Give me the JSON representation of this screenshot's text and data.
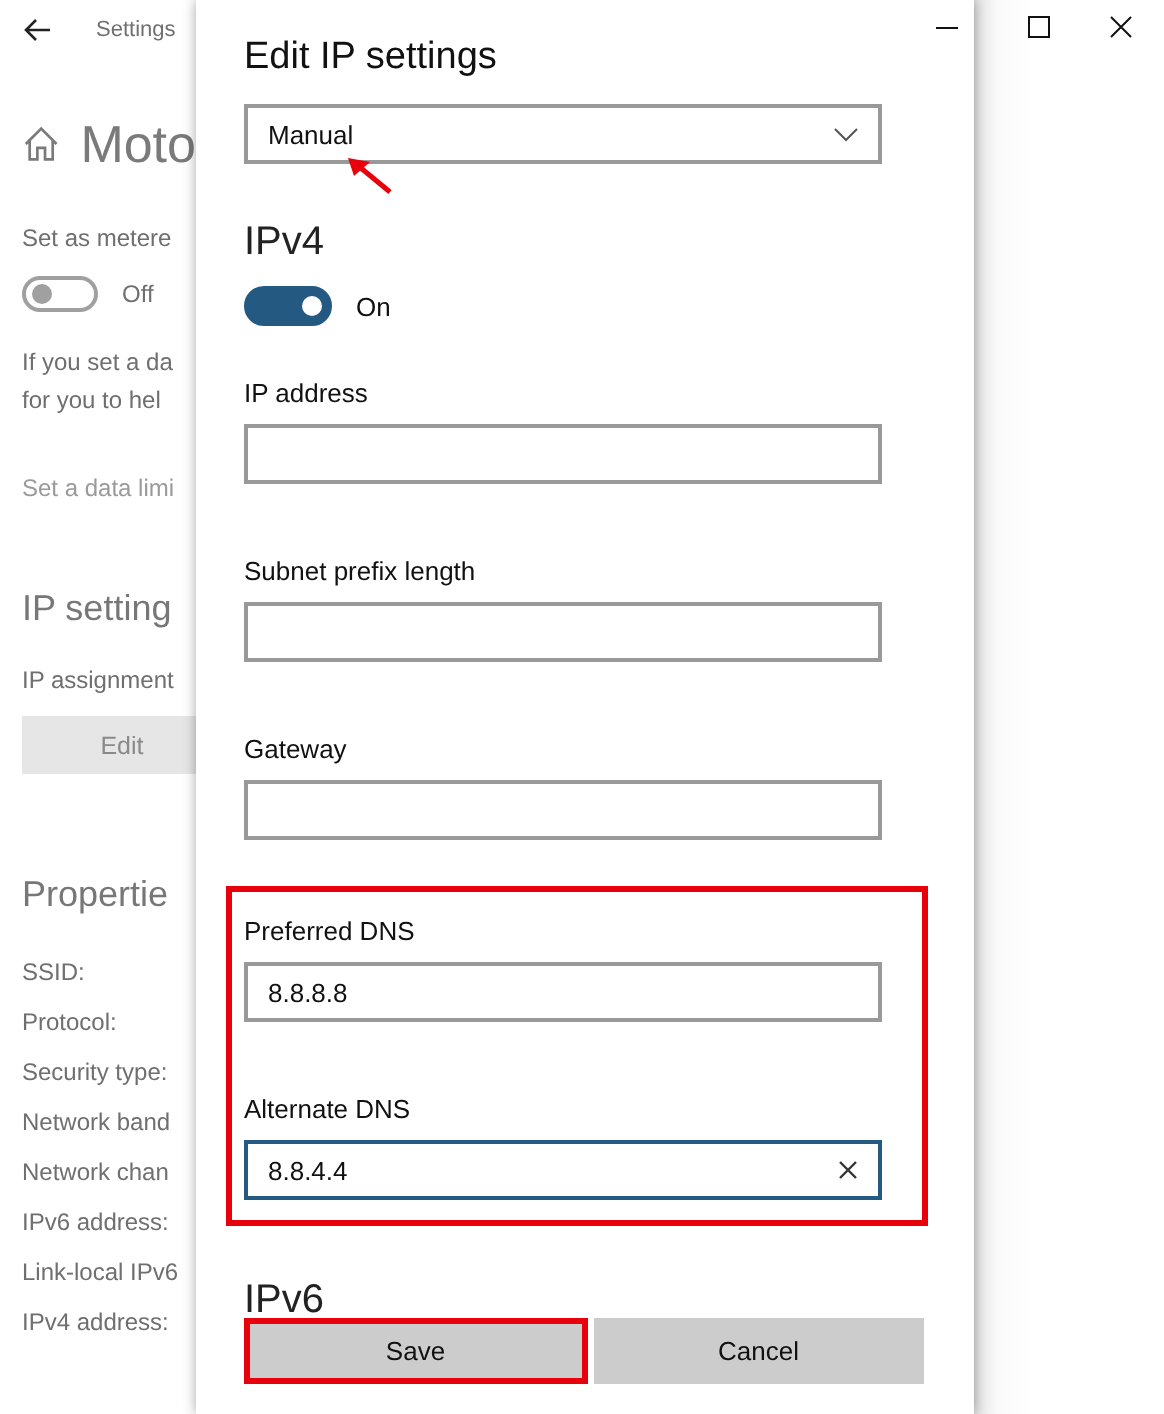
{
  "window": {
    "title": "Settings"
  },
  "background_page": {
    "heading": "Moto",
    "metered": {
      "label": "Set as metere",
      "on": false,
      "state_text": "Off"
    },
    "note_lines": [
      "If you set a da",
      "for you to hel"
    ],
    "data_limit_link": "Set a data limi",
    "ip_settings": {
      "heading": "IP setting",
      "assignment_label": "IP assignment",
      "edit_button": "Edit"
    },
    "properties": {
      "heading": "Propertie",
      "rows": [
        "SSID:",
        "Protocol:",
        "Security type:",
        "Network band",
        "Network chan",
        "IPv6 address:",
        "Link-local IPv6",
        "IPv4 address:"
      ]
    }
  },
  "dialog": {
    "title": "Edit IP settings",
    "mode_dropdown": {
      "value": "Manual"
    },
    "ipv4": {
      "heading": "IPv4",
      "on": true,
      "state_text": "On",
      "fields": [
        {
          "label": "IP address",
          "focused": false,
          "highlighted": false
        },
        {
          "label": "Subnet prefix length",
          "focused": false,
          "highlighted": false
        },
        {
          "label": "Gateway",
          "focused": false,
          "highlighted": false
        },
        {
          "label": "Preferred DNS",
          "value": "8.8.8.8",
          "focused": false,
          "highlighted": true
        },
        {
          "label": "Alternate DNS",
          "value": "8.8.4.4",
          "focused": true,
          "highlighted": true
        }
      ]
    },
    "ipv6_heading": "IPv6",
    "buttons": [
      {
        "label": "Save",
        "highlighted": true
      },
      {
        "label": "Cancel",
        "highlighted": false
      }
    ]
  }
}
